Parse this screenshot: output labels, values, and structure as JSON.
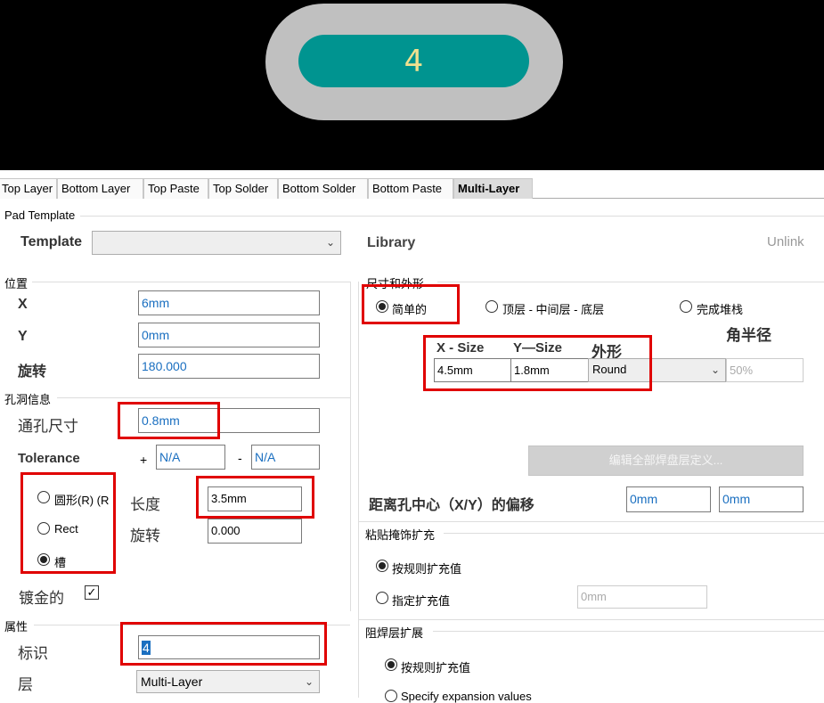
{
  "preview": {
    "pad_label": "4"
  },
  "tabs": [
    "Top Layer",
    "Bottom Layer",
    "Top Paste",
    "Top Solder",
    "Bottom Solder",
    "Bottom Paste",
    "Multi-Layer"
  ],
  "pad_template": {
    "group": "Pad Template",
    "template_label": "Template",
    "template_value": "",
    "library_label": "Library",
    "unlink_label": "Unlink"
  },
  "position": {
    "group": "位置",
    "x_label": "X",
    "x_value": "6mm",
    "y_label": "Y",
    "y_value": "0mm",
    "rotation_label": "旋转",
    "rotation_value": "180.000"
  },
  "hole": {
    "group": "孔洞信息",
    "size_label": "通孔尺寸",
    "size_value": "0.8mm",
    "tolerance_label": "Tolerance",
    "plus": "+",
    "plus_value": "N/A",
    "minus": "-",
    "minus_value": "N/A",
    "shape_round": "圆形(R) (R",
    "shape_rect": "Rect",
    "shape_slot": "槽",
    "length_label": "长度",
    "length_value": "3.5mm",
    "rot_label": "旋转",
    "rot_value": "0.000",
    "plated_label": "镀金的",
    "plated_check": "✓"
  },
  "properties": {
    "group": "属性",
    "designator_label": "标识",
    "designator_value": "4",
    "layer_label": "层",
    "layer_value": "Multi-Layer"
  },
  "size_shape": {
    "group": "尺寸和外形",
    "mode_simple": "简单的",
    "mode_tmb": "顶层 - 中间层 - 底层",
    "mode_full": "完成堆栈",
    "corner_radius_label": "角半径",
    "col_x": "X - Size",
    "col_y": "Y—Size",
    "col_shape": "外形",
    "x_size": "4.5mm",
    "y_size": "1.8mm",
    "shape_value": "Round",
    "corner_value": "50%",
    "edit_button": "编辑全部焊盘层定义...",
    "offset_label": "距离孔中心（X/Y）的偏移",
    "offset_x": "0mm",
    "offset_y": "0mm"
  },
  "paste": {
    "group": "粘贴掩饰扩充",
    "by_rule": "按规则扩充值",
    "specify": "指定扩充值",
    "value": "0mm"
  },
  "solder": {
    "group": "阻焊层扩展",
    "by_rule": "按规则扩充值",
    "specify": "Specify expansion values"
  },
  "icons": {
    "dropdown": "chevron-down-icon",
    "check": "checkbox-icon"
  },
  "colors": {
    "pad_copper": "#009490",
    "pad_ring": "#c0c0c0",
    "pad_text": "#f2e18f",
    "highlight": "#e00000",
    "value_text": "#1a6fc0"
  }
}
